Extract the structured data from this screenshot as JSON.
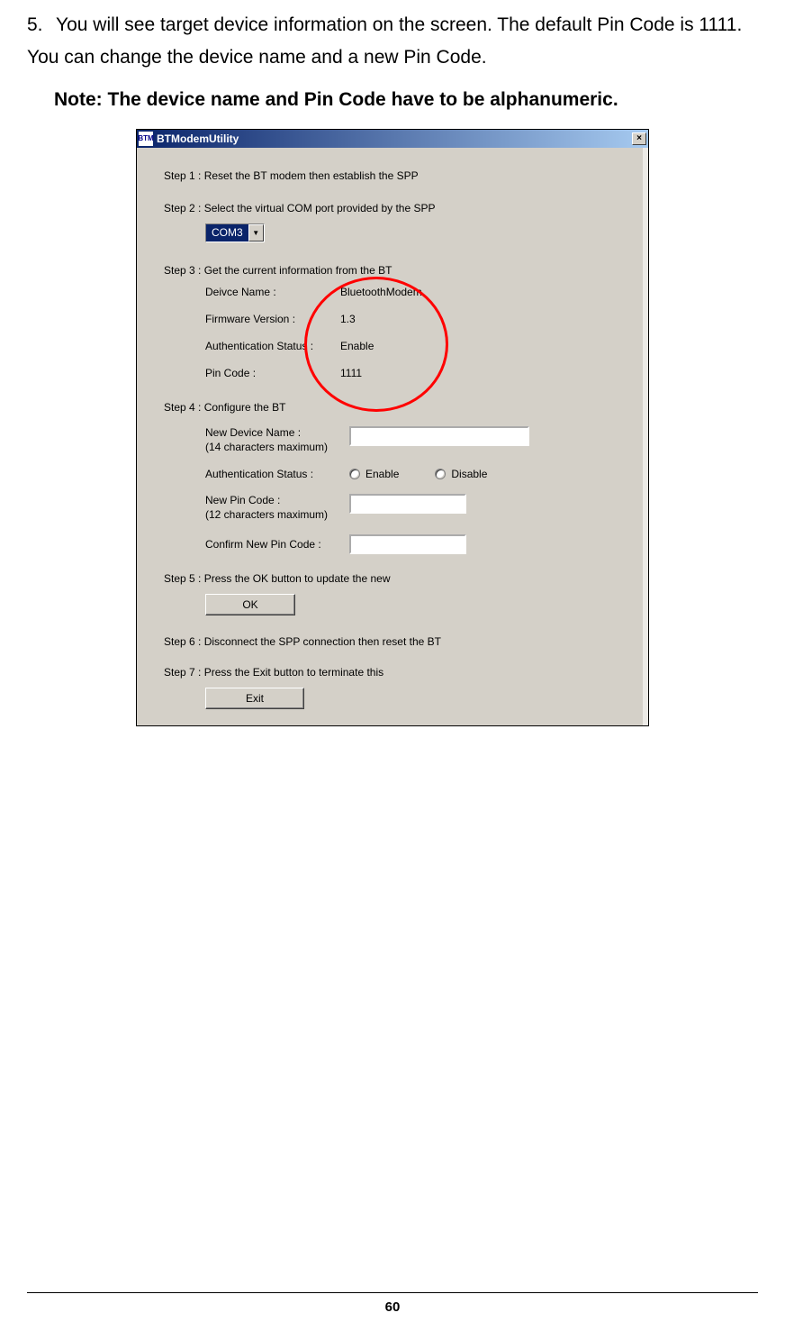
{
  "doc": {
    "bullet_num": "5.",
    "para": "You will see target device information on the screen. The default Pin Code is 1111. You can change the device name and a new Pin Code.",
    "note": "Note: The device name and Pin Code have to be alphanumeric."
  },
  "window": {
    "title": "BTModemUtility",
    "close_symbol": "×",
    "step1": "Step 1 : Reset the BT modem then establish the SPP",
    "step2": "Step 2 : Select the virtual COM port provided by the SPP",
    "com_selected": "COM3",
    "dropdown_arrow": "▼",
    "step3": "Step 3 : Get the current information from the BT",
    "info": {
      "device_name_label": "Deivce Name :",
      "device_name_value": "BluetoothModem",
      "firmware_label": "Firmware Version :",
      "firmware_value": "1.3",
      "auth_label": "Authentication Status :",
      "auth_value": "Enable",
      "pin_label": "Pin Code :",
      "pin_value": "1111"
    },
    "step4": "Step 4 : Configure the BT",
    "cfg": {
      "new_name_label": "New Device Name :\n(14 characters maximum)",
      "auth_status_label": "Authentication Status :",
      "enable_label": "Enable",
      "disable_label": "Disable",
      "new_pin_label": "New Pin Code :\n(12 characters maximum)",
      "confirm_pin_label": "Confirm New Pin Code :"
    },
    "step5": "Step 5 : Press the OK button to update the new",
    "ok_label": "OK",
    "step6": "Step 6 : Disconnect the SPP connection then reset the BT",
    "step7": "Step 7 : Press the Exit button to terminate this",
    "exit_label": "Exit"
  },
  "page_number": "60"
}
